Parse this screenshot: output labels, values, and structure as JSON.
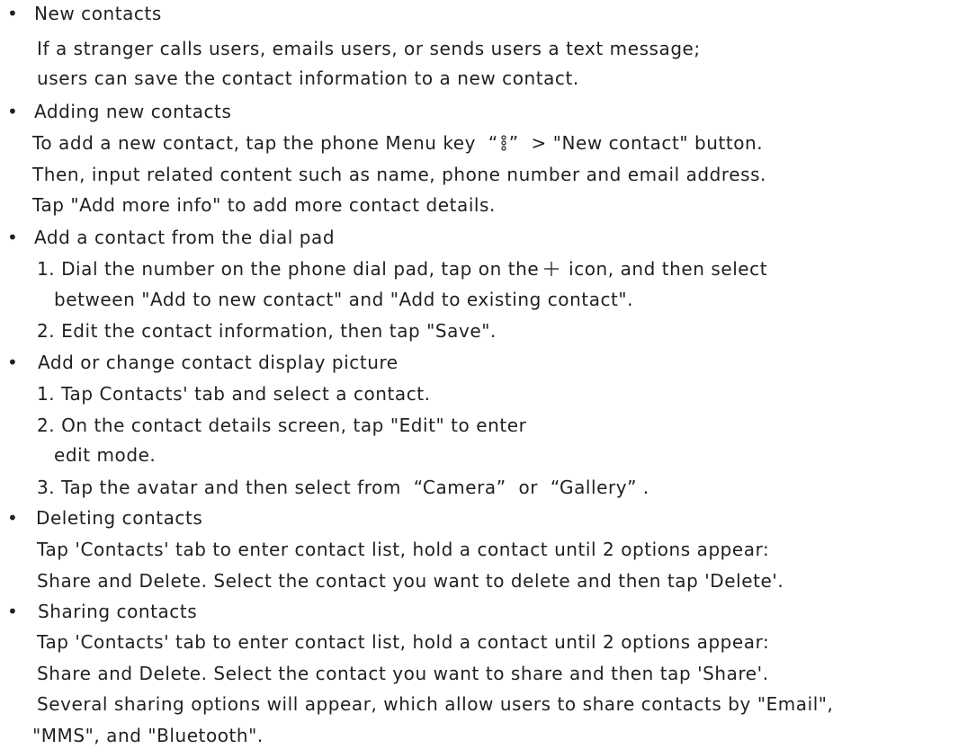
{
  "bullet_glyph": "•",
  "sections": [
    {
      "title": "New contacts",
      "lines": [
        "If a stranger calls users, emails users, or sends users a text message;",
        "users can save the contact information to a new contact."
      ]
    },
    {
      "title": "Adding new contacts",
      "lines": [
        {
          "before": "To add a new contact, tap the phone Menu key  “",
          "icon": "menu-vertical-dots-icon",
          "after": "”  > \"New contact\" button."
        },
        "Then, input related content such as name, phone number and email address.",
        "Tap \"Add more info\" to add more contact details."
      ]
    },
    {
      "title": "Add a contact from the dial pad",
      "lines": [
        {
          "before": "1. Dial the number on the phone dial pad, tap on the",
          "icon": "plus-icon",
          "after": " icon, and then select"
        },
        "between \"Add to new contact\" and \"Add to existing contact\".",
        "2. Edit the contact information, then tap \"Save\"."
      ]
    },
    {
      "title": "Add or change contact display picture",
      "lines": [
        "1. Tap Contacts' tab and select a contact.",
        "2. On the contact details screen, tap \"Edit\" to enter",
        "edit mode.",
        "3. Tap the avatar and then select from  “Camera”  or  “Gallery” ."
      ]
    },
    {
      "title": "Deleting contacts",
      "lines": [
        "Tap 'Contacts' tab to enter contact list, hold a contact until 2 options appear:",
        "Share and Delete. Select the contact you want to delete and then tap 'Delete'."
      ]
    },
    {
      "title": "Sharing contacts",
      "lines": [
        "Tap 'Contacts' tab to enter contact list, hold a contact until 2 options appear:",
        "Share and Delete. Select the contact you want to share and then tap 'Share'.",
        "Several sharing options will appear, which allow users to share contacts by \"Email\",",
        "\"MMS\", and \"Bluetooth\"."
      ]
    }
  ]
}
